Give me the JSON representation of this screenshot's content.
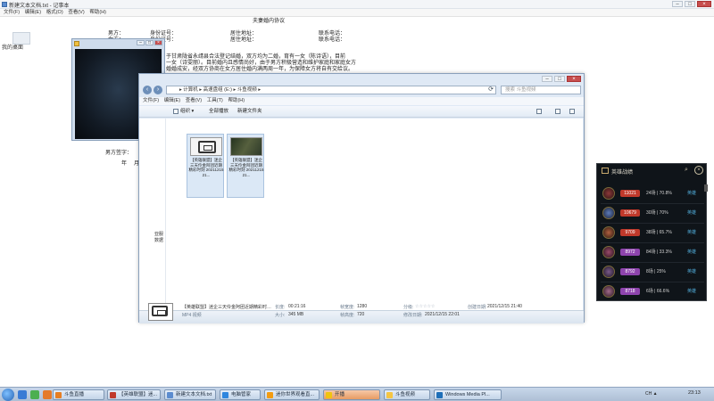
{
  "notepad": {
    "title": "新建文本文档.txt - 记事本",
    "menu": [
      "文件(F)",
      "编辑(E)",
      "格式(O)",
      "查看(V)",
      "帮助(H)"
    ],
    "heading": "夫妻婚内协议",
    "fields": {
      "husband": "男方：",
      "wife": "女方：",
      "id_a": "身份证号：",
      "id_b": "身份证号：",
      "residence_a": "居住地址：",
      "residence_b": "居住地址：",
      "phone_a": "联系电话：",
      "phone_b": "联系电话："
    },
    "body_lines": [
      "于甘肃陇省永靖县合法登记结婚，双方均为二婚，育有一女（陈诗语），目前",
      "一女（诗雯丽）。目前婚内且感情尚好，由于男方积极营造和维护家庭和家庭女方",
      "婚婚成安，经双方协商在女方居住婚内满两周一年，为保障女方将自有交给议。"
    ],
    "signature": "男方签字：",
    "year": "年",
    "month": "月"
  },
  "desktop_icon": {
    "label": "我的桌面"
  },
  "explorer": {
    "breadcrumb": "▸ 计算机 ▸ 高速盘组 (E:) ▸ 斗鱼视频 ▸",
    "search_placeholder": "搜索 斗鱼视频",
    "menu": [
      "文件(F)",
      "编辑(E)",
      "查看(V)",
      "工具(T)",
      "帮助(H)"
    ],
    "toolbar": {
      "organize": "组织 ▾",
      "play_all": "全部播放",
      "new_folder": "新建文件夹"
    },
    "left_item": "亚服数据",
    "files": [
      {
        "name": "【英雄联盟】迷企三天伶金阿团近期精彩时刻 20211215 21..."
      },
      {
        "name": "【英雄联盟】迷企三天伶金阿团近期精彩时刻 20211215 21..."
      }
    ],
    "details": {
      "file_name": "【英雄联盟】迷企三天伶金阿团近期精彩时…",
      "file_type": "MP4 视频",
      "length_label": "长度:",
      "length": "00:21:16",
      "size_label": "大小:",
      "size": "345 MB",
      "width_label": "帧宽度:",
      "width": "1280",
      "height_label": "帧高度:",
      "height": "720",
      "rating_label": "分级:",
      "rating": "☆☆☆☆☆",
      "modified_label": "修改日期:",
      "modified": "2021/12/15 22:01",
      "created_label": "创建日期:",
      "created": "2021/12/15 21:40"
    }
  },
  "game_panel": {
    "title": "英雄战绩",
    "rows": [
      {
        "score": "11021",
        "stat": "24场 | 70.8%",
        "link": "英雄",
        "score_color": "#c0392b"
      },
      {
        "score": "10679",
        "stat": "30场 | 70%",
        "link": "英雄",
        "score_color": "#c0392b"
      },
      {
        "score": "9709",
        "stat": "38场 | 65.7%",
        "link": "英雄",
        "score_color": "#c0392b"
      },
      {
        "score": "8972",
        "stat": "84场 | 33.3%",
        "link": "英雄",
        "score_color": "#8e44ad"
      },
      {
        "score": "8792",
        "stat": "8场 | 25%",
        "link": "英雄",
        "score_color": "#8e44ad"
      },
      {
        "score": "8718",
        "stat": "6场 | 66.6%",
        "link": "英雄",
        "score_color": "#8e44ad"
      }
    ]
  },
  "taskbar": {
    "items": [
      {
        "label": "斗鱼直播"
      },
      {
        "label": "【英雄联盟】迷..."
      },
      {
        "label": "新建文本文档.txt"
      },
      {
        "label": "电脑管家"
      },
      {
        "label": "迷你世界观看直..."
      },
      {
        "label": "开播"
      },
      {
        "label": "斗鱼视频"
      },
      {
        "label": "Windows Media Pl..."
      }
    ],
    "tray": "CH ▲",
    "clock": "23:13"
  },
  "colors": {
    "taskbar_active": "#e79b62",
    "game_bg": "#0f1419",
    "link": "#4fa9d6"
  }
}
